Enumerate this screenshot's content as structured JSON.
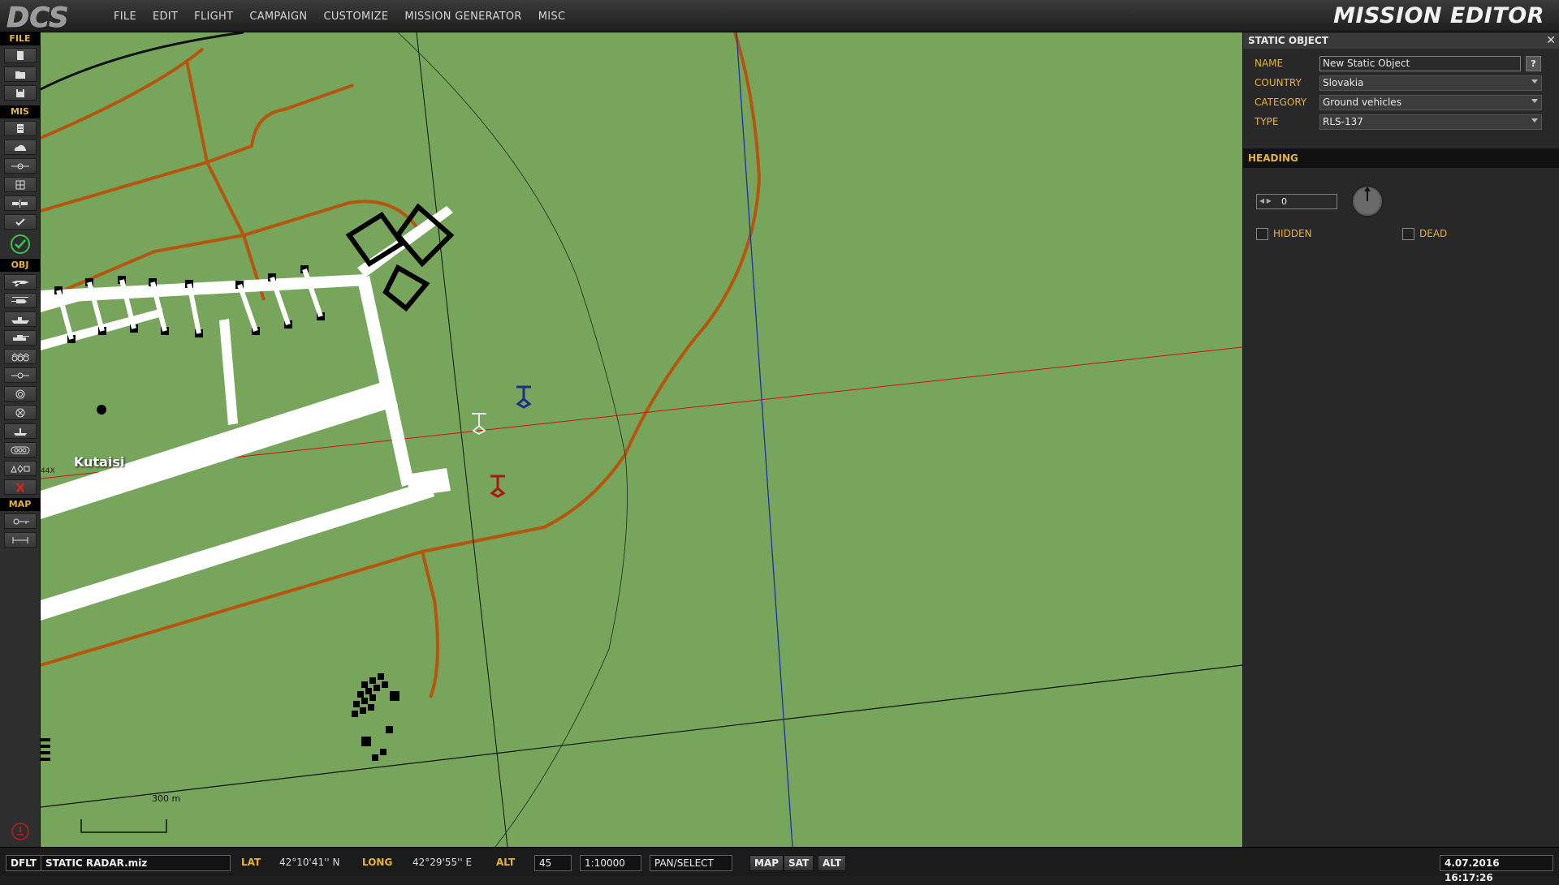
{
  "app": {
    "logo_text": "DCS",
    "title": "MISSION EDITOR"
  },
  "menu": [
    "FILE",
    "EDIT",
    "FLIGHT",
    "CAMPAIGN",
    "CUSTOMIZE",
    "MISSION GENERATOR",
    "MISC"
  ],
  "toolbar": {
    "sections": {
      "file": "FILE",
      "mis": "MIS",
      "obj": "OBJ",
      "map": "MAP"
    },
    "file_buttons": [
      "new-mission-icon",
      "open-mission-icon",
      "save-mission-icon"
    ],
    "mis_buttons": [
      "briefing-icon",
      "weather-icon",
      "triggers-icon",
      "resources-icon",
      "goals-icon",
      "check-icon"
    ],
    "obj_buttons": [
      "aircraft-icon",
      "helicopter-icon",
      "ship-icon",
      "ground-vehicle-icon",
      "convoy-icon",
      "waypoint-icon",
      "static-object-icon",
      "fortification-icon",
      "naval-static-icon",
      "group-icon",
      "shapes-icon",
      "delete-icon"
    ],
    "map_buttons": [
      "map-options-icon",
      "ruler-icon"
    ]
  },
  "map": {
    "airfield_label": "Kutaisi",
    "runway_code": "44X",
    "scale_label": "300 m",
    "colors": {
      "background": "#77a55c",
      "roads": "#b5550e",
      "runway": "#ffffff",
      "red_line": "#d01010",
      "blue_line": "#1a2fb0"
    }
  },
  "panel": {
    "title": "STATIC OBJECT",
    "close_label": "✕",
    "fields": {
      "name_label": "NAME",
      "name_value": "New Static Object",
      "country_label": "COUNTRY",
      "country_value": "Slovakia",
      "category_label": "CATEGORY",
      "category_value": "Ground vehicles",
      "type_label": "TYPE",
      "type_value": "RLS-137",
      "help_label": "?"
    },
    "heading": {
      "title": "HEADING",
      "value": "0",
      "degrees": 0
    },
    "checkboxes": {
      "hidden_label": "HIDDEN",
      "hidden_checked": false,
      "dead_label": "DEAD",
      "dead_checked": false
    }
  },
  "statusbar": {
    "preset": "DFLT",
    "filename": "STATIC RADAR.miz",
    "lat_label": "LAT",
    "lat_value": "42°10'41'' N",
    "long_label": "LONG",
    "long_value": "42°29'55'' E",
    "alt_label": "ALT",
    "alt_value": "45",
    "scale_value": "1:10000",
    "mode": "PAN/SELECT",
    "map_btn": "MAP",
    "sat_btn": "SAT",
    "alt_btn": "ALT",
    "datetime": "4.07.2016 16:17:26"
  }
}
